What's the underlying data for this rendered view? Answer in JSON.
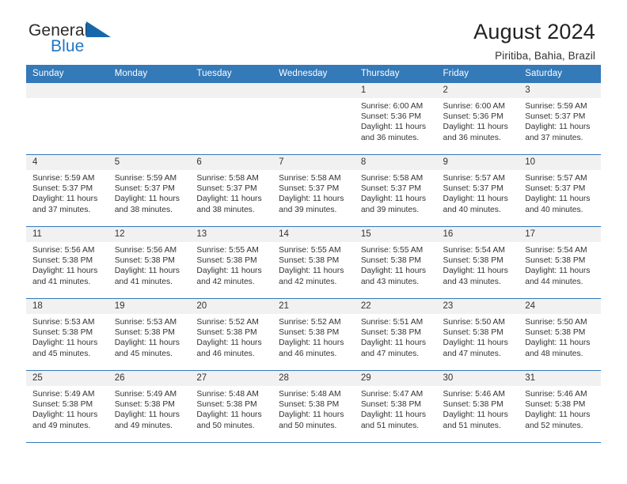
{
  "brand": {
    "word1": "General",
    "word2": "Blue",
    "flag_icon": "blue-triangle-flag-icon"
  },
  "header": {
    "title": "August 2024",
    "subtitle": "Piritiba, Bahia, Brazil"
  },
  "calendar": {
    "weekday_headers": [
      "Sunday",
      "Monday",
      "Tuesday",
      "Wednesday",
      "Thursday",
      "Friday",
      "Saturday"
    ],
    "header_bg": "#3479b8",
    "daynum_bg": "#f1f1f1",
    "weeks": [
      [
        {
          "day": "",
          "empty": true
        },
        {
          "day": "",
          "empty": true
        },
        {
          "day": "",
          "empty": true
        },
        {
          "day": "",
          "empty": true
        },
        {
          "day": "1",
          "sunrise": "Sunrise: 6:00 AM",
          "sunset": "Sunset: 5:36 PM",
          "daylight1": "Daylight: 11 hours",
          "daylight2": "and 36 minutes."
        },
        {
          "day": "2",
          "sunrise": "Sunrise: 6:00 AM",
          "sunset": "Sunset: 5:36 PM",
          "daylight1": "Daylight: 11 hours",
          "daylight2": "and 36 minutes."
        },
        {
          "day": "3",
          "sunrise": "Sunrise: 5:59 AM",
          "sunset": "Sunset: 5:37 PM",
          "daylight1": "Daylight: 11 hours",
          "daylight2": "and 37 minutes."
        }
      ],
      [
        {
          "day": "4",
          "sunrise": "Sunrise: 5:59 AM",
          "sunset": "Sunset: 5:37 PM",
          "daylight1": "Daylight: 11 hours",
          "daylight2": "and 37 minutes."
        },
        {
          "day": "5",
          "sunrise": "Sunrise: 5:59 AM",
          "sunset": "Sunset: 5:37 PM",
          "daylight1": "Daylight: 11 hours",
          "daylight2": "and 38 minutes."
        },
        {
          "day": "6",
          "sunrise": "Sunrise: 5:58 AM",
          "sunset": "Sunset: 5:37 PM",
          "daylight1": "Daylight: 11 hours",
          "daylight2": "and 38 minutes."
        },
        {
          "day": "7",
          "sunrise": "Sunrise: 5:58 AM",
          "sunset": "Sunset: 5:37 PM",
          "daylight1": "Daylight: 11 hours",
          "daylight2": "and 39 minutes."
        },
        {
          "day": "8",
          "sunrise": "Sunrise: 5:58 AM",
          "sunset": "Sunset: 5:37 PM",
          "daylight1": "Daylight: 11 hours",
          "daylight2": "and 39 minutes."
        },
        {
          "day": "9",
          "sunrise": "Sunrise: 5:57 AM",
          "sunset": "Sunset: 5:37 PM",
          "daylight1": "Daylight: 11 hours",
          "daylight2": "and 40 minutes."
        },
        {
          "day": "10",
          "sunrise": "Sunrise: 5:57 AM",
          "sunset": "Sunset: 5:37 PM",
          "daylight1": "Daylight: 11 hours",
          "daylight2": "and 40 minutes."
        }
      ],
      [
        {
          "day": "11",
          "sunrise": "Sunrise: 5:56 AM",
          "sunset": "Sunset: 5:38 PM",
          "daylight1": "Daylight: 11 hours",
          "daylight2": "and 41 minutes."
        },
        {
          "day": "12",
          "sunrise": "Sunrise: 5:56 AM",
          "sunset": "Sunset: 5:38 PM",
          "daylight1": "Daylight: 11 hours",
          "daylight2": "and 41 minutes."
        },
        {
          "day": "13",
          "sunrise": "Sunrise: 5:55 AM",
          "sunset": "Sunset: 5:38 PM",
          "daylight1": "Daylight: 11 hours",
          "daylight2": "and 42 minutes."
        },
        {
          "day": "14",
          "sunrise": "Sunrise: 5:55 AM",
          "sunset": "Sunset: 5:38 PM",
          "daylight1": "Daylight: 11 hours",
          "daylight2": "and 42 minutes."
        },
        {
          "day": "15",
          "sunrise": "Sunrise: 5:55 AM",
          "sunset": "Sunset: 5:38 PM",
          "daylight1": "Daylight: 11 hours",
          "daylight2": "and 43 minutes."
        },
        {
          "day": "16",
          "sunrise": "Sunrise: 5:54 AM",
          "sunset": "Sunset: 5:38 PM",
          "daylight1": "Daylight: 11 hours",
          "daylight2": "and 43 minutes."
        },
        {
          "day": "17",
          "sunrise": "Sunrise: 5:54 AM",
          "sunset": "Sunset: 5:38 PM",
          "daylight1": "Daylight: 11 hours",
          "daylight2": "and 44 minutes."
        }
      ],
      [
        {
          "day": "18",
          "sunrise": "Sunrise: 5:53 AM",
          "sunset": "Sunset: 5:38 PM",
          "daylight1": "Daylight: 11 hours",
          "daylight2": "and 45 minutes."
        },
        {
          "day": "19",
          "sunrise": "Sunrise: 5:53 AM",
          "sunset": "Sunset: 5:38 PM",
          "daylight1": "Daylight: 11 hours",
          "daylight2": "and 45 minutes."
        },
        {
          "day": "20",
          "sunrise": "Sunrise: 5:52 AM",
          "sunset": "Sunset: 5:38 PM",
          "daylight1": "Daylight: 11 hours",
          "daylight2": "and 46 minutes."
        },
        {
          "day": "21",
          "sunrise": "Sunrise: 5:52 AM",
          "sunset": "Sunset: 5:38 PM",
          "daylight1": "Daylight: 11 hours",
          "daylight2": "and 46 minutes."
        },
        {
          "day": "22",
          "sunrise": "Sunrise: 5:51 AM",
          "sunset": "Sunset: 5:38 PM",
          "daylight1": "Daylight: 11 hours",
          "daylight2": "and 47 minutes."
        },
        {
          "day": "23",
          "sunrise": "Sunrise: 5:50 AM",
          "sunset": "Sunset: 5:38 PM",
          "daylight1": "Daylight: 11 hours",
          "daylight2": "and 47 minutes."
        },
        {
          "day": "24",
          "sunrise": "Sunrise: 5:50 AM",
          "sunset": "Sunset: 5:38 PM",
          "daylight1": "Daylight: 11 hours",
          "daylight2": "and 48 minutes."
        }
      ],
      [
        {
          "day": "25",
          "sunrise": "Sunrise: 5:49 AM",
          "sunset": "Sunset: 5:38 PM",
          "daylight1": "Daylight: 11 hours",
          "daylight2": "and 49 minutes."
        },
        {
          "day": "26",
          "sunrise": "Sunrise: 5:49 AM",
          "sunset": "Sunset: 5:38 PM",
          "daylight1": "Daylight: 11 hours",
          "daylight2": "and 49 minutes."
        },
        {
          "day": "27",
          "sunrise": "Sunrise: 5:48 AM",
          "sunset": "Sunset: 5:38 PM",
          "daylight1": "Daylight: 11 hours",
          "daylight2": "and 50 minutes."
        },
        {
          "day": "28",
          "sunrise": "Sunrise: 5:48 AM",
          "sunset": "Sunset: 5:38 PM",
          "daylight1": "Daylight: 11 hours",
          "daylight2": "and 50 minutes."
        },
        {
          "day": "29",
          "sunrise": "Sunrise: 5:47 AM",
          "sunset": "Sunset: 5:38 PM",
          "daylight1": "Daylight: 11 hours",
          "daylight2": "and 51 minutes."
        },
        {
          "day": "30",
          "sunrise": "Sunrise: 5:46 AM",
          "sunset": "Sunset: 5:38 PM",
          "daylight1": "Daylight: 11 hours",
          "daylight2": "and 51 minutes."
        },
        {
          "day": "31",
          "sunrise": "Sunrise: 5:46 AM",
          "sunset": "Sunset: 5:38 PM",
          "daylight1": "Daylight: 11 hours",
          "daylight2": "and 52 minutes."
        }
      ]
    ]
  }
}
